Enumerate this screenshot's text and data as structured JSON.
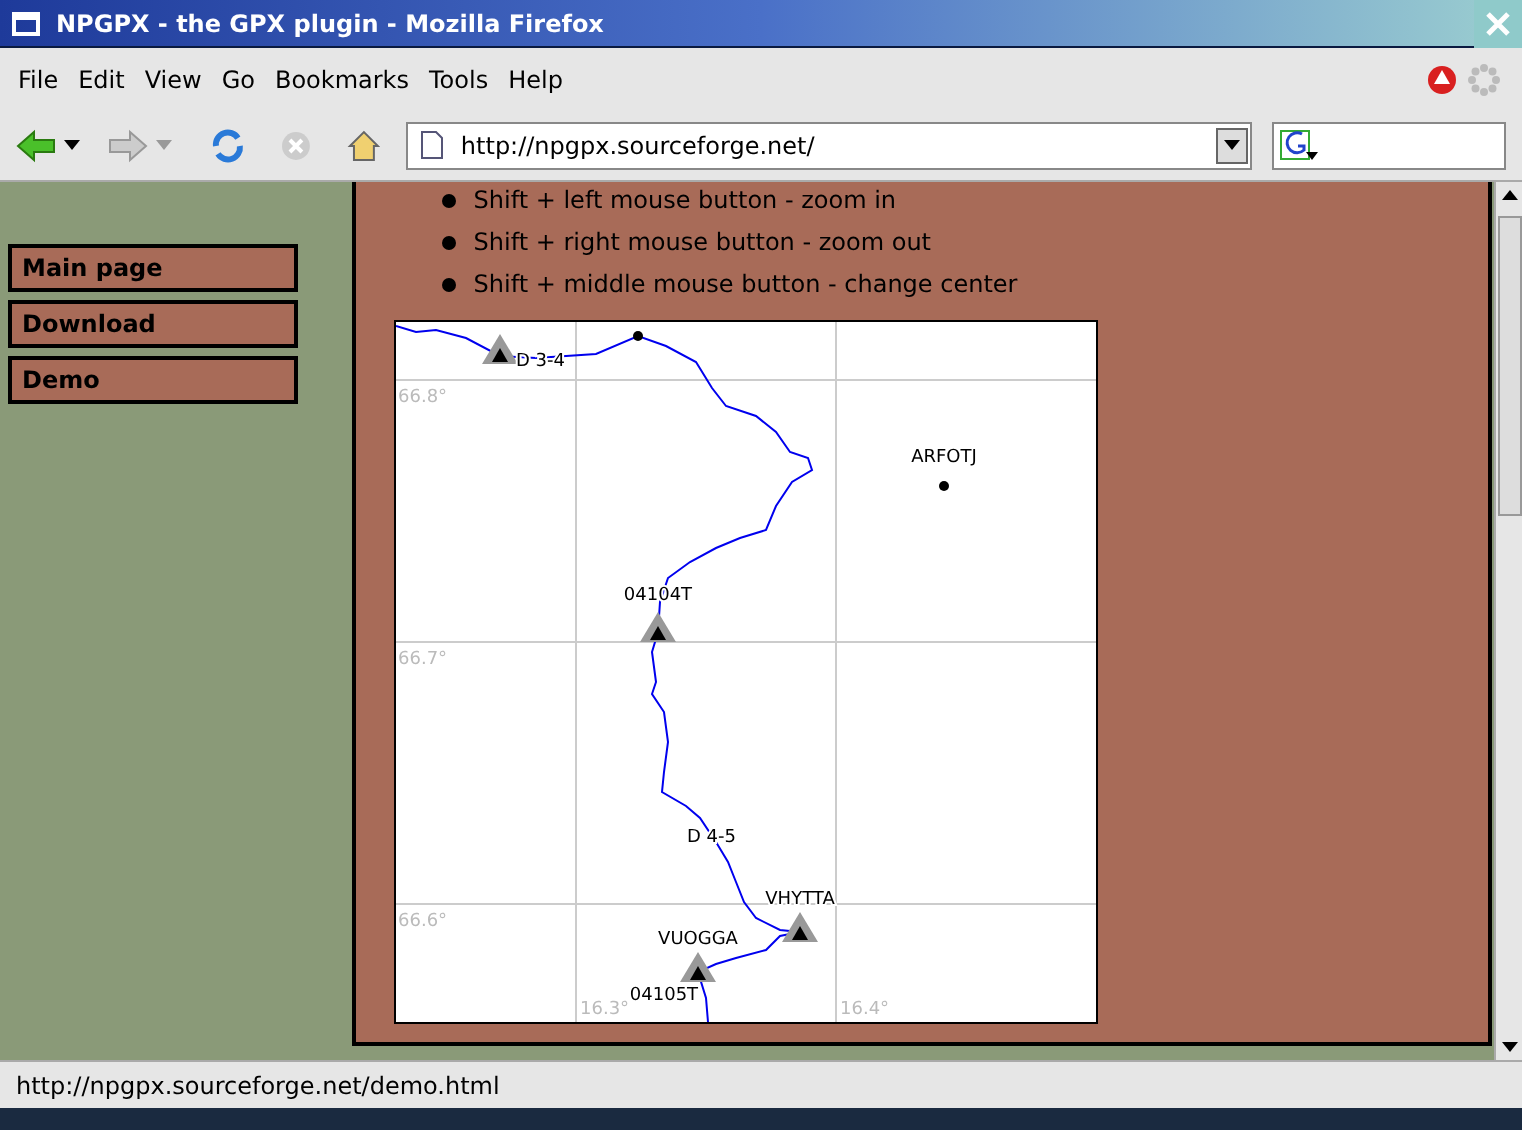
{
  "window": {
    "title": "NPGPX - the GPX plugin - Mozilla Firefox"
  },
  "menu": [
    {
      "label": "File"
    },
    {
      "label": "Edit"
    },
    {
      "label": "View"
    },
    {
      "label": "Go"
    },
    {
      "label": "Bookmarks"
    },
    {
      "label": "Tools"
    },
    {
      "label": "Help"
    }
  ],
  "toolbar": {
    "back_disabled": false,
    "forward_disabled": true,
    "stop_disabled": true,
    "url": "http://npgpx.sourceforge.net/"
  },
  "sidebar": {
    "items": [
      {
        "label": "Main page"
      },
      {
        "label": "Download"
      },
      {
        "label": "Demo"
      }
    ]
  },
  "content": {
    "bullets": [
      "Shift + left mouse button - zoom in",
      "Shift + right mouse button - zoom out",
      "Shift + middle mouse button - change center"
    ],
    "map": {
      "lat_labels": [
        "66.8°",
        "66.7°",
        "66.6°"
      ],
      "lon_labels": [
        "16.3°",
        "16.4°"
      ],
      "waypoints": [
        {
          "kind": "tent",
          "name": "D 3-4"
        },
        {
          "kind": "dot"
        },
        {
          "kind": "dot",
          "name": "ARFOTJ"
        },
        {
          "kind": "tent",
          "name": "04104T"
        },
        {
          "kind": "label",
          "name": "D 4-5"
        },
        {
          "kind": "tent",
          "name": "VHYTTA"
        },
        {
          "kind": "tent",
          "name": "VUOGGA"
        },
        {
          "kind": "label",
          "name": "04105T"
        }
      ]
    }
  },
  "status_bar": {
    "text": "http://npgpx.sourceforge.net/demo.html"
  }
}
